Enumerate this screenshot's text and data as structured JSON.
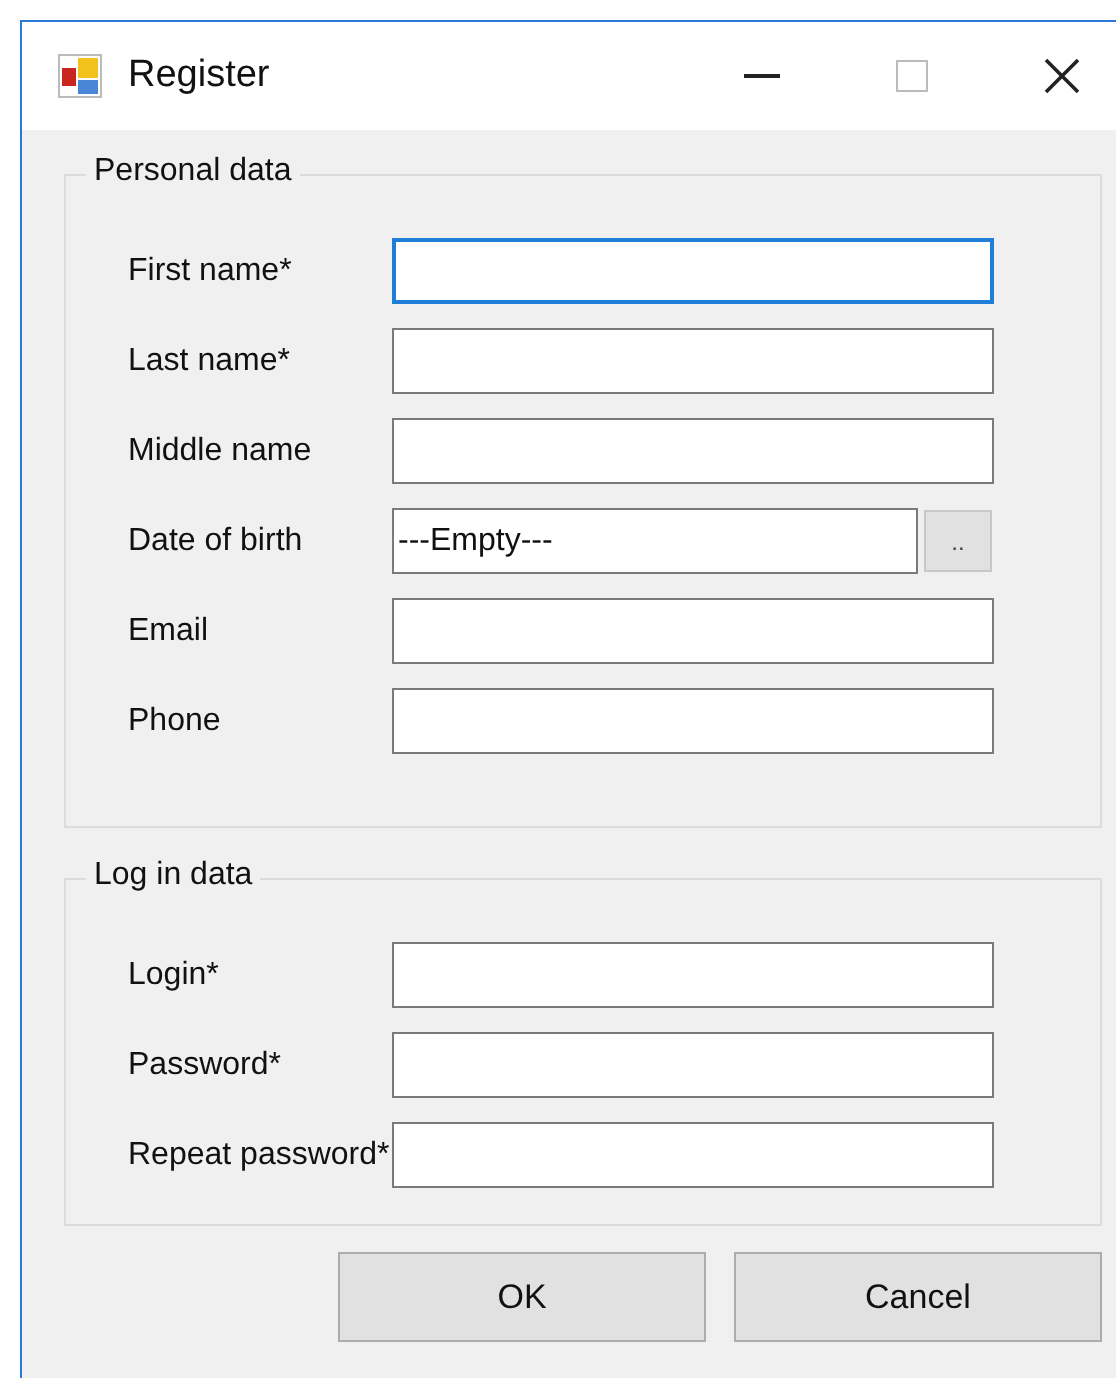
{
  "window": {
    "title": "Register"
  },
  "groups": [
    {
      "title": "Personal data",
      "fields": [
        {
          "label": "First name*",
          "kind": "text",
          "focused": true
        },
        {
          "label": "Last name*",
          "kind": "text",
          "focused": false
        },
        {
          "label": "Middle name",
          "kind": "text",
          "focused": false
        },
        {
          "label": "Date of birth",
          "kind": "date",
          "value": "---Empty---",
          "button": "..",
          "focused": false
        },
        {
          "label": "Email",
          "kind": "text",
          "focused": false
        },
        {
          "label": "Phone",
          "kind": "text",
          "focused": false
        }
      ]
    },
    {
      "title": "Log in data",
      "fields": [
        {
          "label": "Login*",
          "kind": "text",
          "focused": false
        },
        {
          "label": "Password*",
          "kind": "text",
          "focused": false
        },
        {
          "label": "Repeat password*",
          "kind": "text",
          "focused": false
        }
      ]
    }
  ],
  "buttons": [
    "OK",
    "Cancel"
  ]
}
